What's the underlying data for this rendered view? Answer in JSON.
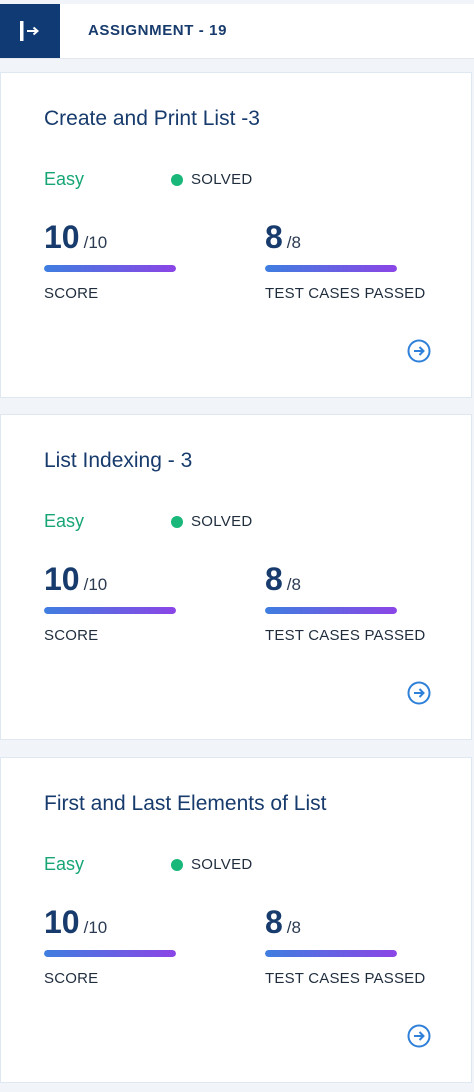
{
  "header": {
    "title": "ASSIGNMENT - 19",
    "sidebar_toggle_icon": "sidebar-expand-icon"
  },
  "colors": {
    "primary": "#0f3a73",
    "title_text": "#173b6c",
    "easy": "#17a673",
    "solved_dot": "#19b77a",
    "bar_start": "#3f7ee0",
    "bar_end": "#8b45e6"
  },
  "questions": [
    {
      "title": "Create and Print List -3",
      "difficulty": "Easy",
      "status": "SOLVED",
      "score": "10",
      "score_total": "/10",
      "score_fraction": 1.0,
      "score_label": "SCORE",
      "tests": "8",
      "tests_total": "/8",
      "tests_fraction": 1.0,
      "tests_label": "TEST CASES PASSED",
      "arrow_icon": "arrow-right-circle-icon"
    },
    {
      "title": "List Indexing - 3",
      "difficulty": "Easy",
      "status": "SOLVED",
      "score": "10",
      "score_total": "/10",
      "score_fraction": 1.0,
      "score_label": "SCORE",
      "tests": "8",
      "tests_total": "/8",
      "tests_fraction": 1.0,
      "tests_label": "TEST CASES PASSED",
      "arrow_icon": "arrow-right-circle-icon"
    },
    {
      "title": "First and Last Elements of List",
      "difficulty": "Easy",
      "status": "SOLVED",
      "score": "10",
      "score_total": "/10",
      "score_fraction": 1.0,
      "score_label": "SCORE",
      "tests": "8",
      "tests_total": "/8",
      "tests_fraction": 1.0,
      "tests_label": "TEST CASES PASSED",
      "arrow_icon": "arrow-right-circle-icon"
    }
  ]
}
